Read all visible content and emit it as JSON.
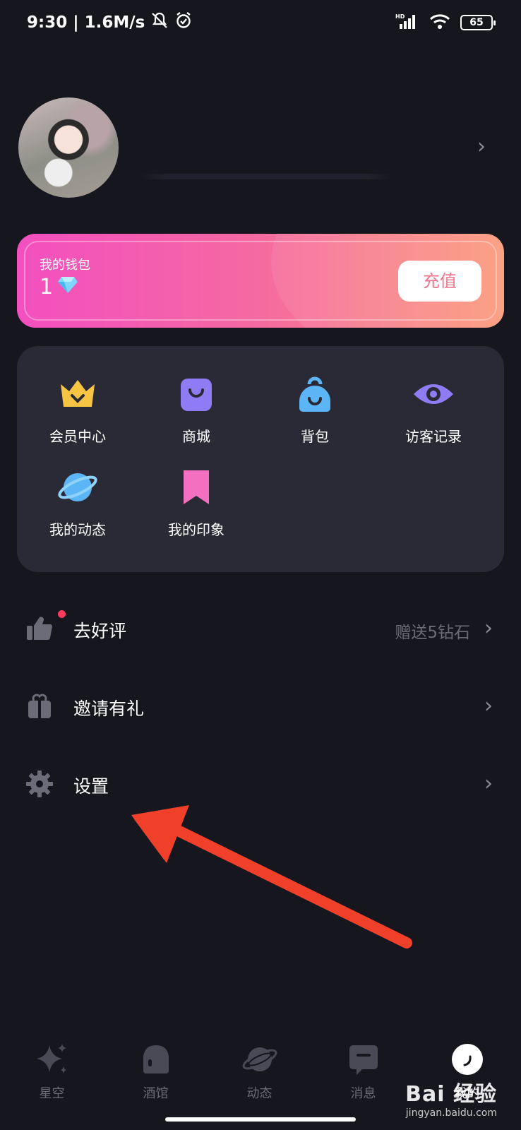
{
  "status_bar": {
    "time": "9:30",
    "speed": "1.6M/s",
    "battery": "65"
  },
  "wallet": {
    "title": "我的钱包",
    "amount": "1",
    "recharge_label": "充值"
  },
  "grid": [
    {
      "label": "会员中心",
      "icon": "crown-icon",
      "color": "#f6c544"
    },
    {
      "label": "商城",
      "icon": "shopping-bag-icon",
      "color": "#8f7cf5"
    },
    {
      "label": "背包",
      "icon": "backpack-icon",
      "color": "#5cb6f5"
    },
    {
      "label": "访客记录",
      "icon": "eye-icon",
      "color": "#8f7cf5"
    },
    {
      "label": "我的动态",
      "icon": "planet-icon",
      "color": "#5cb6f5"
    },
    {
      "label": "我的印象",
      "icon": "bookmark-icon",
      "color": "#f36fc0"
    }
  ],
  "list": [
    {
      "label": "去好评",
      "extra": "赠送5钻石",
      "icon": "thumbs-up-icon"
    },
    {
      "label": "邀请有礼",
      "extra": "",
      "icon": "gift-icon"
    },
    {
      "label": "设置",
      "extra": "",
      "icon": "gear-icon"
    }
  ],
  "tabs": [
    {
      "label": "星空",
      "icon": "sparkle-icon"
    },
    {
      "label": "酒馆",
      "icon": "tavern-icon"
    },
    {
      "label": "动态",
      "icon": "planet-icon"
    },
    {
      "label": "消息",
      "icon": "message-icon"
    },
    {
      "label": "我的",
      "icon": "profile-icon",
      "active": true
    }
  ],
  "watermark": {
    "main": "Bai 经验",
    "sub": "jingyan.baidu.com"
  },
  "colors": {
    "background": "#16161f",
    "card": "#2a2a36",
    "wallet_gradient_start": "#f34fc0",
    "wallet_gradient_end": "#fb9a7a",
    "arrow": "#f0402a"
  }
}
